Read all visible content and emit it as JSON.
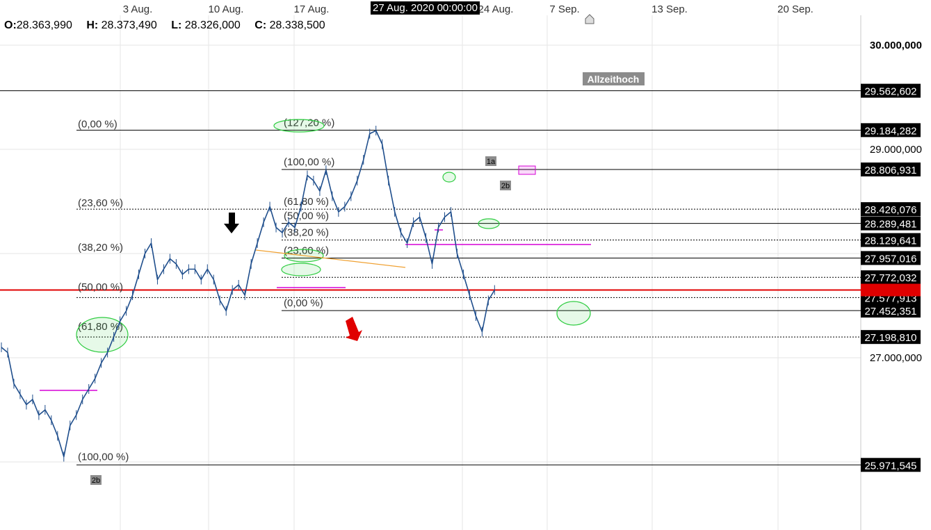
{
  "ohlc": {
    "o_label": "O:",
    "o_value": "28.363,990",
    "h_label": "H:",
    "h_value": "28.373,490",
    "l_label": "L:",
    "l_value": "28.326,000",
    "c_label": "C:",
    "c_value": "28.338,500"
  },
  "hover_date": "27 Aug. 2020 00:00:00",
  "colors": {
    "candles": "#1f4e8c",
    "current_price_line": "#e00000",
    "fib_lines": "#000000",
    "magenta_levels": "#d600d6",
    "green_circles": "#2ecc40",
    "trendline": "#f0a030",
    "grid": "#e6e6e6"
  },
  "chart_data": {
    "type": "line",
    "x_axis": {
      "ticks": [
        "3 Aug.",
        "10 Aug.",
        "17 Aug.",
        "24 Aug.",
        "7 Sep.",
        "13 Sep.",
        "20 Sep."
      ]
    },
    "y_axis": {
      "ticks": [
        "30.000,000",
        "29.000,000",
        "27.000,000"
      ],
      "range": [
        25600000,
        30500000
      ]
    },
    "price_labels": [
      {
        "text": "29.562,602",
        "value": 29562602,
        "style": "solid"
      },
      {
        "text": "29.184,282",
        "value": 29184282,
        "style": "solid"
      },
      {
        "text": "28.806,931",
        "value": 28806931,
        "style": "solid"
      },
      {
        "text": "28.426,076",
        "value": 28426076,
        "style": "dotted"
      },
      {
        "text": "28.289,481",
        "value": 28289481,
        "style": "solid"
      },
      {
        "text": "28.129,641",
        "value": 28129641,
        "style": "dotted"
      },
      {
        "text": "27.957,016",
        "value": 27957016,
        "style": "solid"
      },
      {
        "text": "27.772,032",
        "value": 27772032,
        "style": "dotted"
      },
      {
        "text": "27.577,913",
        "value": 27577913,
        "style": "dotted"
      },
      {
        "text": "27.452,351",
        "value": 27452351,
        "style": "solid"
      },
      {
        "text": "27.198,810",
        "value": 27198810,
        "style": "dotted"
      },
      {
        "text": "25.971,545",
        "value": 25971545,
        "style": "solid"
      }
    ],
    "current_price": 27650000,
    "annotations": {
      "ath_label": "Allzeithoch",
      "fib_large": [
        "(0,00 %)",
        "(23,60 %)",
        "(38,20 %)",
        "(50,00 %)",
        "(61,80 %)",
        "(100,00 %)"
      ],
      "fib_small": [
        "(127,20 %)",
        "(100,00 %)",
        "(61,80 %)",
        "(50,00 %)",
        "(38,20 %)",
        "(23,60 %)",
        "(0,00 %)"
      ],
      "wave_labels": [
        "1a",
        "2b",
        "2b"
      ]
    },
    "series": [
      {
        "x_index": [
          0,
          3,
          6,
          9,
          12,
          15,
          18,
          21,
          24,
          27,
          30,
          33,
          36,
          39,
          42,
          45,
          48,
          51,
          54,
          57,
          60,
          63,
          66,
          69,
          72,
          75,
          78,
          81,
          84,
          87,
          90,
          93,
          96,
          99,
          102,
          105,
          108,
          111,
          114,
          117,
          120,
          123,
          126,
          129,
          132,
          135,
          138,
          141,
          144,
          147,
          150,
          153,
          156,
          159,
          162,
          165,
          168,
          171,
          174,
          177,
          180,
          183,
          186,
          189,
          192,
          195,
          198,
          201,
          204,
          207,
          210,
          213,
          216,
          219,
          222,
          225,
          228,
          231,
          234,
          237,
          240,
          243,
          246,
          249,
          252,
          255,
          258,
          261,
          264,
          267,
          270,
          273,
          276,
          279,
          282
        ],
        "close": [
          27100000,
          27050000,
          26750000,
          26650000,
          26550000,
          26600000,
          26450000,
          26500000,
          26400000,
          26250000,
          26050000,
          26350000,
          26450000,
          26600000,
          26700000,
          26800000,
          26950000,
          27050000,
          27200000,
          27350000,
          27450000,
          27600000,
          27800000,
          28000000,
          28100000,
          27750000,
          27850000,
          27950000,
          27900000,
          27800000,
          27850000,
          27850000,
          27750000,
          27850000,
          27750000,
          27550000,
          27450000,
          27650000,
          27700000,
          27600000,
          27900000,
          28100000,
          28300000,
          28450000,
          28250000,
          28200000,
          28300000,
          28250000,
          28450000,
          28750000,
          28700000,
          28600000,
          28800000,
          28550000,
          28400000,
          28450000,
          28550000,
          28700000,
          28900000,
          29150000,
          29180000,
          29050000,
          28700000,
          28400000,
          28200000,
          28100000,
          28300000,
          28350000,
          28150000,
          27900000,
          28250000,
          28350000,
          28400000,
          28000000,
          27800000,
          27600000,
          27400000,
          27250000,
          27550000,
          27650000
        ]
      }
    ]
  }
}
